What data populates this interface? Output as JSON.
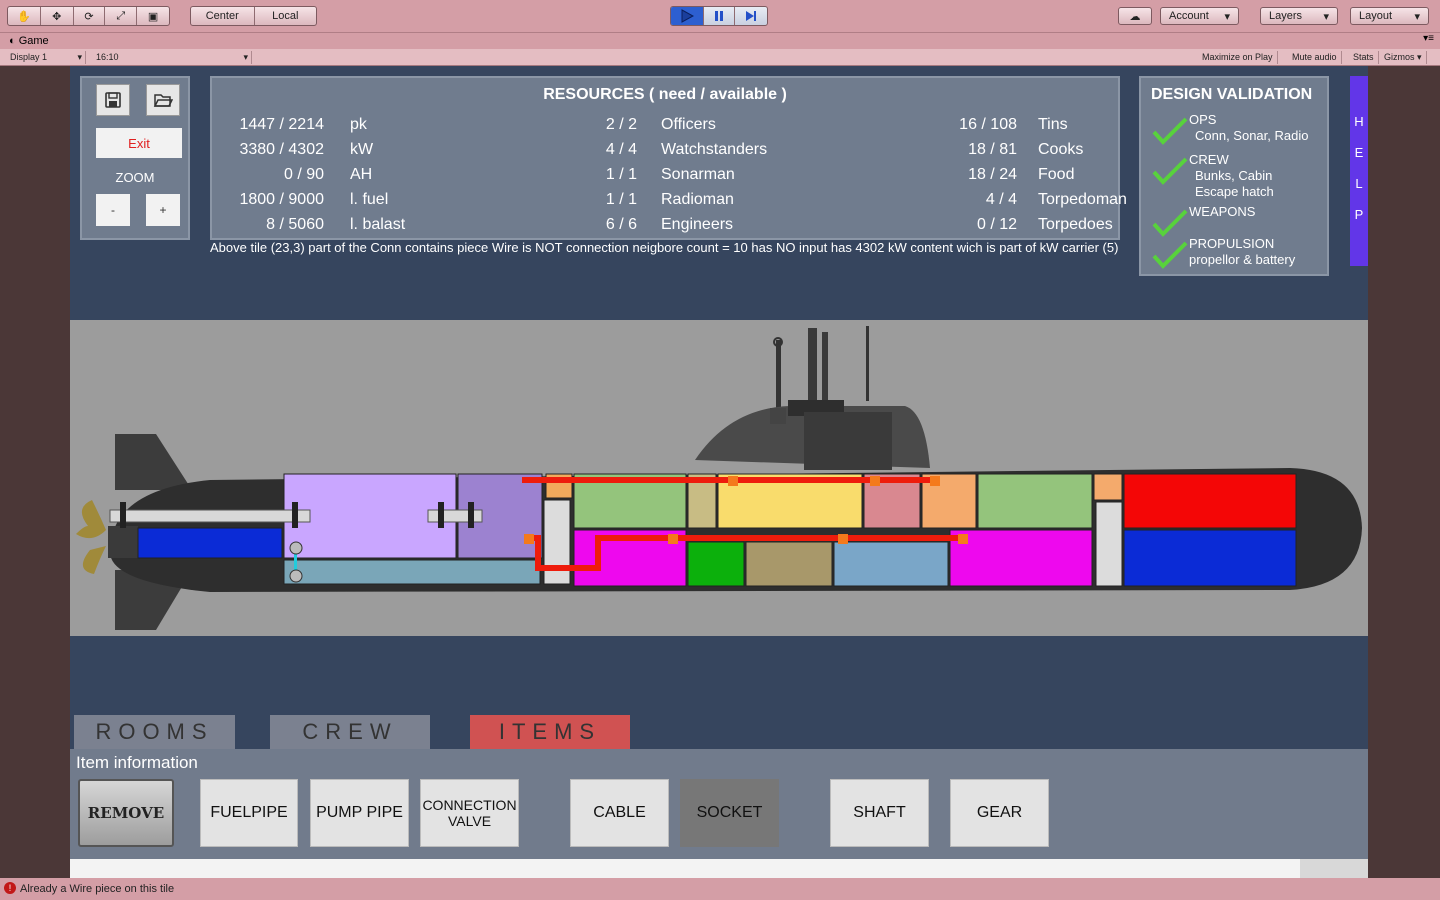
{
  "toolbar": {
    "transform_tools": [
      "hand-icon",
      "move-icon",
      "rotate-icon",
      "scale-icon",
      "rect-icon"
    ],
    "pivot": "Center",
    "space": "Local",
    "account": "Account",
    "layers": "Layers",
    "layout": "Layout"
  },
  "game_tab": {
    "title": "Game",
    "display": "Display 1",
    "aspect": "16:10",
    "options": [
      "Maximize on Play",
      "Mute audio",
      "Stats",
      "Gizmos"
    ]
  },
  "left_panel": {
    "exit_label": "Exit",
    "zoom_label": "ZOOM",
    "zoom_out": "-",
    "zoom_in": "+"
  },
  "resources": {
    "title": "RESOURCES ( need / available )",
    "col1": [
      {
        "value": "1447 / 2214",
        "unit": "pk"
      },
      {
        "value": "3380 / 4302",
        "unit": "kW"
      },
      {
        "value": "0 / 90",
        "unit": "AH"
      },
      {
        "value": "1800 / 9000",
        "unit": "l. fuel"
      },
      {
        "value": "8 / 5060",
        "unit": "l. balast"
      }
    ],
    "col2": [
      {
        "value": "2 / 2",
        "unit": "Officers"
      },
      {
        "value": "4 / 4",
        "unit": "Watchstanders"
      },
      {
        "value": "1 / 1",
        "unit": "Sonarman"
      },
      {
        "value": "1 / 1",
        "unit": "Radioman"
      },
      {
        "value": "6 / 6",
        "unit": "Engineers"
      }
    ],
    "col3": [
      {
        "value": "16 / 108",
        "unit": "Tins"
      },
      {
        "value": "18 / 81",
        "unit": "Cooks"
      },
      {
        "value": "18 / 24",
        "unit": "Food"
      },
      {
        "value": "4 / 4",
        "unit": "Torpedoman"
      },
      {
        "value": "0 / 12",
        "unit": "Torpedoes"
      }
    ],
    "info": "Above tile (23,3) part of the Conn contains piece Wire is NOT  connection neigbore count = 10 has NO input  has 4302 kW content wich is part of kW carrier (5)"
  },
  "design_validation": {
    "title": "DESIGN VALIDATION",
    "items": [
      {
        "label": "OPS",
        "detail": "Conn, Sonar, Radio"
      },
      {
        "label": "CREW",
        "detail": "Bunks, Cabin\nEscape hatch"
      },
      {
        "label": "WEAPONS",
        "detail": ""
      },
      {
        "label": "PROPULSION",
        "detail": "propellor & battery"
      }
    ]
  },
  "help_letters": [
    "H",
    "E",
    "L",
    "P"
  ],
  "tabs": {
    "rooms": "ROOMS",
    "crew": "CREW",
    "items": "ITEMS"
  },
  "items_panel": {
    "title": "Item information",
    "remove": "REMOVE",
    "buttons": [
      "FUELPIPE",
      "PUMP PIPE",
      "CONNECTION VALVE",
      "CABLE",
      "SOCKET",
      "SHAFT",
      "GEAR"
    ]
  },
  "status": "Already a Wire piece on this tile",
  "colors": {
    "rooms_tab": "#7b8190",
    "items_tab": "#d05252",
    "help": "#6236e8",
    "check": "#58d23c"
  }
}
